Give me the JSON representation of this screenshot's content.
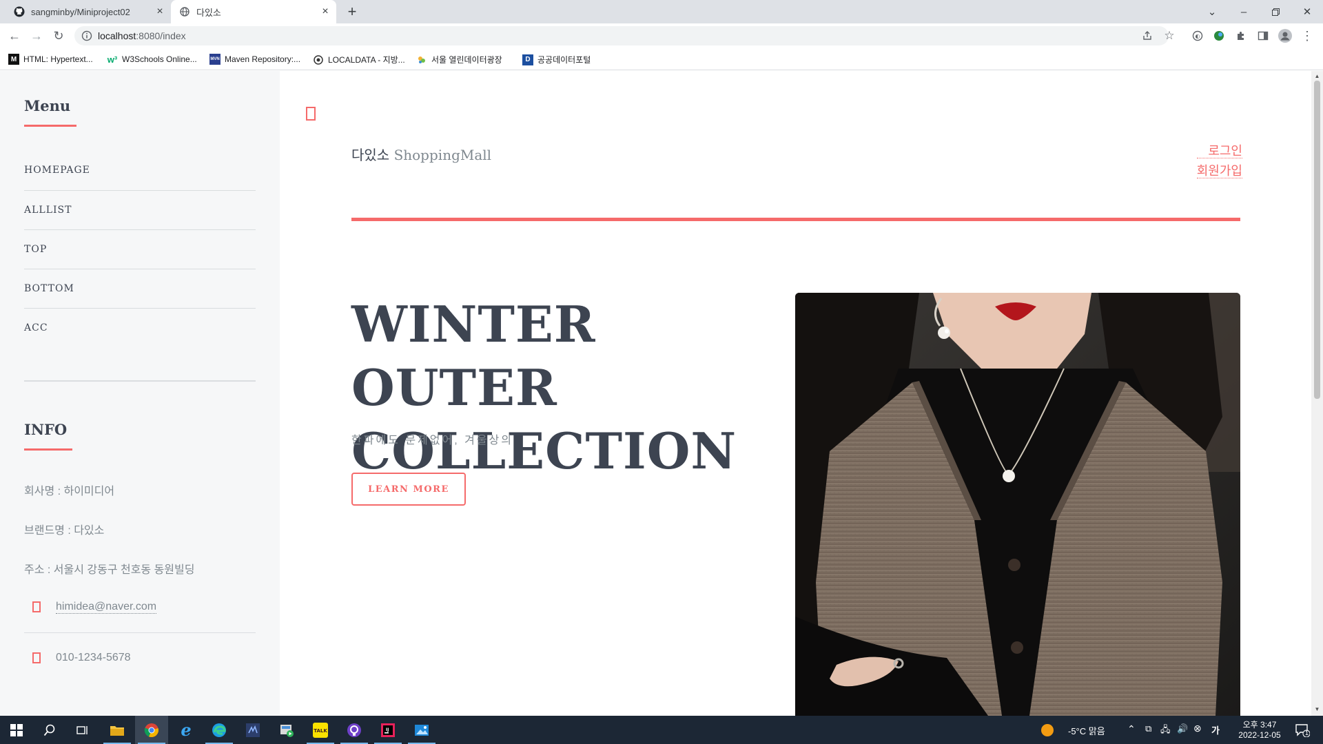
{
  "browser": {
    "tabs": [
      {
        "title": "sangminby/Miniproject02",
        "icon": "github-icon",
        "active": false
      },
      {
        "title": "다있소",
        "icon": "globe-icon",
        "active": true
      }
    ],
    "url_host": "localhost",
    "url_path": ":8080/index",
    "bookmarks": [
      {
        "label": "HTML: Hypertext...",
        "icon": "mdn-icon"
      },
      {
        "label": "W3Schools Online...",
        "icon": "w3schools-icon"
      },
      {
        "label": "Maven Repository:...",
        "icon": "maven-icon"
      },
      {
        "label": "LOCALDATA - 지방...",
        "icon": "localdata-icon"
      },
      {
        "label": "서울 열린데이터광장",
        "icon": "seoul-icon"
      },
      {
        "label": "공공데이터포털",
        "icon": "data-portal-icon"
      }
    ]
  },
  "sidebar": {
    "menu_heading": "Menu",
    "menu_items": [
      "HOMEPAGE",
      "ALLLIST",
      "TOP",
      "BOTTOM",
      "ACC"
    ],
    "info_heading": "INFO",
    "company": "회사명 : 하이미디어",
    "brand": "브랜드명 : 다있소",
    "address": "주소 : 서울시 강동구 천호동 동원빌딩",
    "email": "himidea@naver.com",
    "phone": "010-1234-5678"
  },
  "header": {
    "logo_strong": "다있소",
    "logo_sub": "ShoppingMall",
    "login": "로그인",
    "signup": "회원가입"
  },
  "hero": {
    "title_line1": "WINTER OUTER",
    "title_line2": "COLLECTION",
    "subtitle": "한파에도 문제없어, 겨울상의",
    "button": "LEARN MORE"
  },
  "taskbar": {
    "weather": "-5°C  맑음",
    "time": "오후 3:47",
    "date": "2022-12-05",
    "notifications": "1"
  },
  "colors": {
    "accent": "#f56a6a",
    "text": "#3d4451",
    "muted": "#7f888f",
    "sidebar_bg": "#f6f7f8"
  }
}
